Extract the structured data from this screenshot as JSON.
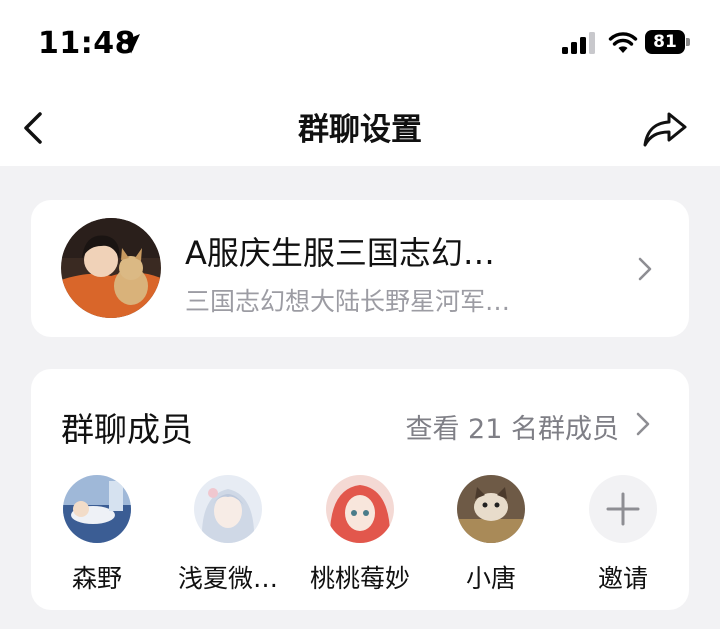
{
  "status_bar": {
    "time": "11:48",
    "battery": "81",
    "icons": [
      "location-arrow-icon",
      "signal-icon",
      "wifi-icon",
      "battery-icon"
    ]
  },
  "nav": {
    "title": "群聊设置",
    "icons": [
      "back-icon",
      "share-icon"
    ]
  },
  "group": {
    "name": "A服庆生服三国志幻…",
    "description": "三国志幻想大陆长野星河军…"
  },
  "members": {
    "title": "群聊成员",
    "view_all": "查看 21 名群成员",
    "list": [
      {
        "name": "森野"
      },
      {
        "name": "浅夏微…"
      },
      {
        "name": "桃桃莓妙"
      },
      {
        "name": "小唐"
      }
    ],
    "invite_label": "邀请"
  },
  "colors": {
    "background": "#f2f2f4",
    "card": "#ffffff",
    "secondary_text": "#9c9ca3"
  }
}
